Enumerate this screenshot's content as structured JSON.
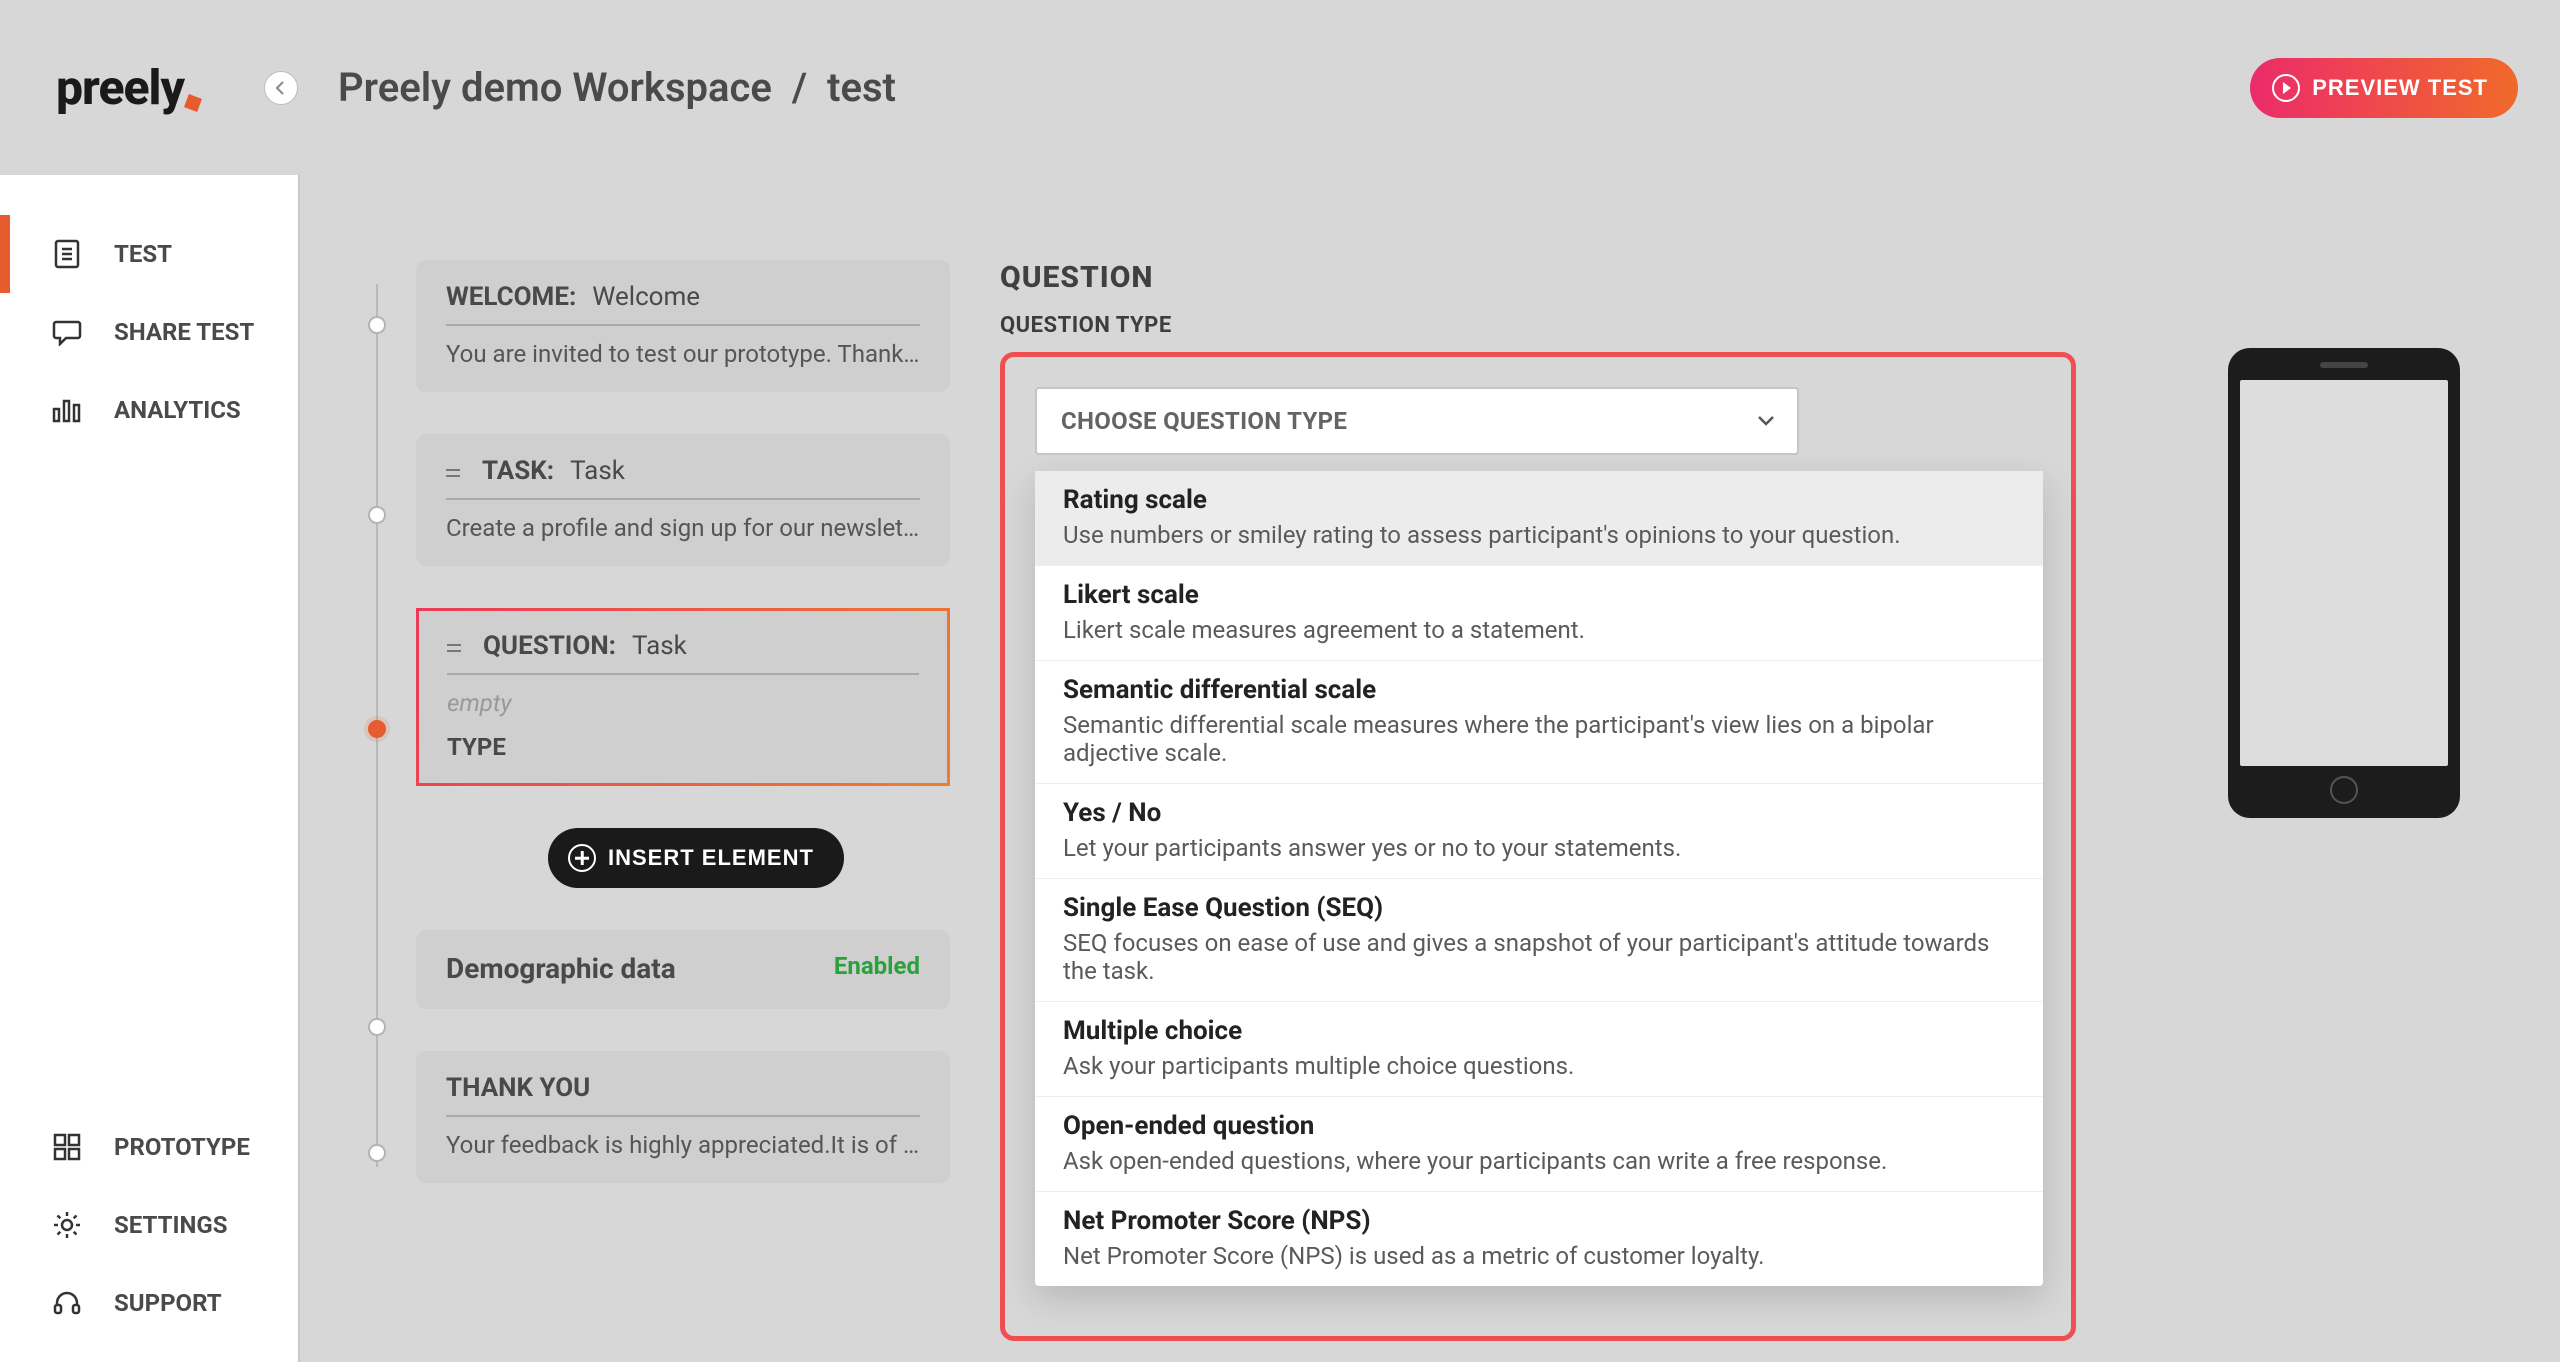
{
  "header": {
    "logo": "preely",
    "breadcrumb_workspace": "Preely demo Workspace",
    "breadcrumb_sep": "/",
    "breadcrumb_current": "test",
    "preview_label": "PREVIEW TEST"
  },
  "sidebar": {
    "top": [
      {
        "label": "TEST"
      },
      {
        "label": "SHARE TEST"
      },
      {
        "label": "ANALYTICS"
      }
    ],
    "bottom": [
      {
        "label": "PROTOTYPE"
      },
      {
        "label": "SETTINGS"
      },
      {
        "label": "SUPPORT"
      }
    ]
  },
  "steps": {
    "welcome": {
      "label": "WELCOME:",
      "value": "Welcome",
      "desc": "You are invited to test our prototype. Thank yo…"
    },
    "task": {
      "label": "TASK:",
      "value": "Task",
      "desc": "Create a profile and sign up for our newsletter."
    },
    "question": {
      "label": "QUESTION:",
      "value": "Task",
      "empty": "empty",
      "type": "TYPE"
    },
    "insert_label": "INSERT ELEMENT",
    "demographic": {
      "label": "Demographic data",
      "badge": "Enabled"
    },
    "thankyou": {
      "label": "THANK YOU",
      "desc": "Your feedback is highly appreciated.It is of gr…"
    }
  },
  "detail": {
    "heading": "QUESTION",
    "subheading": "QUESTION TYPE",
    "dropdown_label": "CHOOSE QUESTION TYPE",
    "options": [
      {
        "title": "Rating scale",
        "desc": "Use numbers or smiley rating to assess participant's opinions to your question."
      },
      {
        "title": "Likert scale",
        "desc": "Likert scale measures agreement to a statement."
      },
      {
        "title": "Semantic differential scale",
        "desc": "Semantic differential scale measures where the participant's view lies on a bipolar adjective scale."
      },
      {
        "title": "Yes / No",
        "desc": "Let your participants answer yes or no to your statements."
      },
      {
        "title": "Single Ease Question (SEQ)",
        "desc": "SEQ focuses on ease of use and gives a snapshot of your participant's attitude towards the task."
      },
      {
        "title": "Multiple choice",
        "desc": "Ask your participants multiple choice questions."
      },
      {
        "title": "Open-ended question",
        "desc": "Ask open-ended questions, where your participants can write a free response."
      },
      {
        "title": "Net Promoter Score (NPS)",
        "desc": "Net Promoter Score (NPS) is used as a metric of customer loyalty."
      }
    ]
  }
}
